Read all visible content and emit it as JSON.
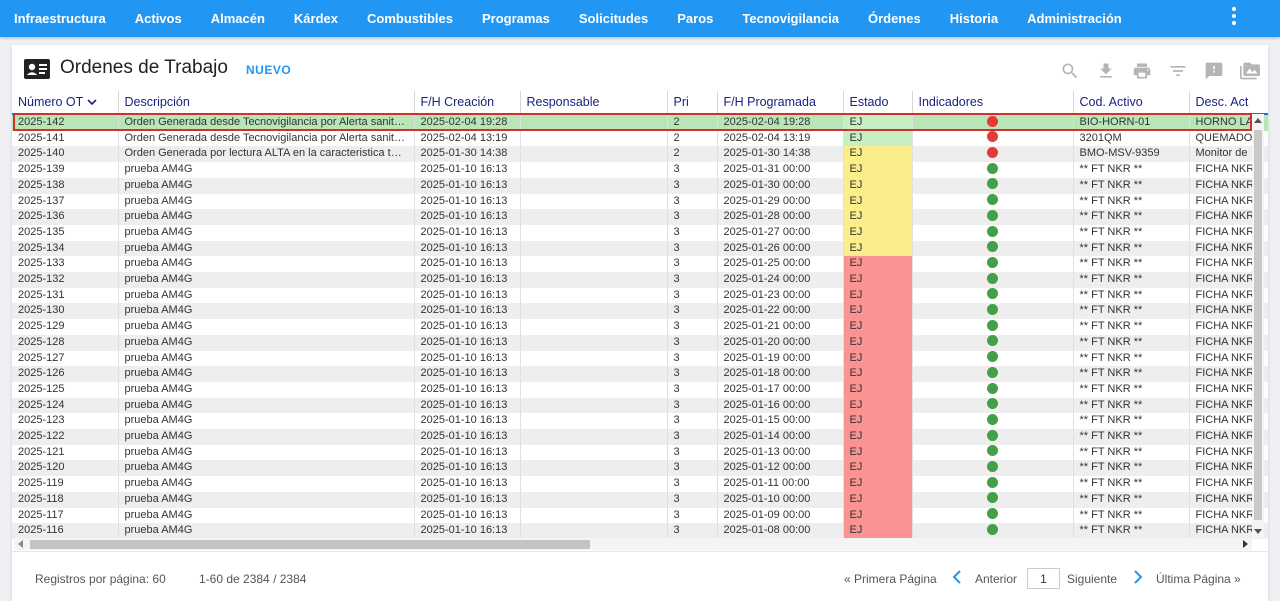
{
  "nav": {
    "items": [
      "Infraestructura",
      "Activos",
      "Almacén",
      "Kárdex",
      "Combustibles",
      "Programas",
      "Solicitudes",
      "Paros",
      "Tecnovigilancia",
      "Órdenes",
      "Historia",
      "Administración"
    ],
    "more_icon": "more-vert-icon"
  },
  "header": {
    "title": "Ordenes de Trabajo",
    "new_label": "NUEVO",
    "tools": [
      "search-icon",
      "download-icon",
      "print-icon",
      "filter-icon",
      "feedback-icon",
      "gallery-icon"
    ]
  },
  "colors": {
    "nav": "#2196f3",
    "status_green": "#c6f0c2",
    "status_yellow": "#fbee8a",
    "status_red": "#f99493",
    "dot_red": "#e53935",
    "dot_green": "#43a047",
    "selected_outline": "#d32f2f"
  },
  "table": {
    "columns": [
      "Número OT",
      "Descripción",
      "F/H Creación",
      "Responsable",
      "Pri",
      "F/H Programada",
      "Estado",
      "Indicadores",
      "Cod. Activo",
      "Desc. Act"
    ],
    "rows": [
      {
        "ot": "2025-142",
        "desc": "Orden Generada desde Tecnovigilancia por Alerta sanitaria",
        "created": "2025-02-04 19:28",
        "resp": "",
        "pri": "2",
        "sched": "2025-02-04 19:28",
        "estado": "EJ",
        "status": "green",
        "ind": "red",
        "cod": "BIO-HORN-01",
        "descact": "HORNO LA"
      },
      {
        "ot": "2025-141",
        "desc": "Orden Generada desde Tecnovigilancia por Alerta sanitaria",
        "created": "2025-02-04 13:19",
        "resp": "",
        "pri": "2",
        "sched": "2025-02-04 13:19",
        "estado": "EJ",
        "status": "green",
        "ind": "red",
        "cod": "3201QM",
        "descact": "QUEMADOR"
      },
      {
        "ot": "2025-140",
        "desc": "Orden Generada por lectura ALTA en la caracteristica temperatura",
        "created": "2025-01-30 14:38",
        "resp": "",
        "pri": "2",
        "sched": "2025-01-30 14:38",
        "estado": "EJ",
        "status": "yellow",
        "ind": "red",
        "cod": "BMO-MSV-9359",
        "descact": "Monitor de"
      },
      {
        "ot": "2025-139",
        "desc": "prueba AM4G",
        "created": "2025-01-10 16:13",
        "resp": "",
        "pri": "3",
        "sched": "2025-01-31 00:00",
        "estado": "EJ",
        "status": "yellow",
        "ind": "green",
        "cod": "** FT NKR **",
        "descact": "FICHA NKR"
      },
      {
        "ot": "2025-138",
        "desc": "prueba AM4G",
        "created": "2025-01-10 16:13",
        "resp": "",
        "pri": "3",
        "sched": "2025-01-30 00:00",
        "estado": "EJ",
        "status": "yellow",
        "ind": "green",
        "cod": "** FT NKR **",
        "descact": "FICHA NKR"
      },
      {
        "ot": "2025-137",
        "desc": "prueba AM4G",
        "created": "2025-01-10 16:13",
        "resp": "",
        "pri": "3",
        "sched": "2025-01-29 00:00",
        "estado": "EJ",
        "status": "yellow",
        "ind": "green",
        "cod": "** FT NKR **",
        "descact": "FICHA NKR"
      },
      {
        "ot": "2025-136",
        "desc": "prueba AM4G",
        "created": "2025-01-10 16:13",
        "resp": "",
        "pri": "3",
        "sched": "2025-01-28 00:00",
        "estado": "EJ",
        "status": "yellow",
        "ind": "green",
        "cod": "** FT NKR **",
        "descact": "FICHA NKR"
      },
      {
        "ot": "2025-135",
        "desc": "prueba AM4G",
        "created": "2025-01-10 16:13",
        "resp": "",
        "pri": "3",
        "sched": "2025-01-27 00:00",
        "estado": "EJ",
        "status": "yellow",
        "ind": "green",
        "cod": "** FT NKR **",
        "descact": "FICHA NKR"
      },
      {
        "ot": "2025-134",
        "desc": "prueba AM4G",
        "created": "2025-01-10 16:13",
        "resp": "",
        "pri": "3",
        "sched": "2025-01-26 00:00",
        "estado": "EJ",
        "status": "yellow",
        "ind": "green",
        "cod": "** FT NKR **",
        "descact": "FICHA NKR"
      },
      {
        "ot": "2025-133",
        "desc": "prueba AM4G",
        "created": "2025-01-10 16:13",
        "resp": "",
        "pri": "3",
        "sched": "2025-01-25 00:00",
        "estado": "EJ",
        "status": "red",
        "ind": "green",
        "cod": "** FT NKR **",
        "descact": "FICHA NKR"
      },
      {
        "ot": "2025-132",
        "desc": "prueba AM4G",
        "created": "2025-01-10 16:13",
        "resp": "",
        "pri": "3",
        "sched": "2025-01-24 00:00",
        "estado": "EJ",
        "status": "red",
        "ind": "green",
        "cod": "** FT NKR **",
        "descact": "FICHA NKR"
      },
      {
        "ot": "2025-131",
        "desc": "prueba AM4G",
        "created": "2025-01-10 16:13",
        "resp": "",
        "pri": "3",
        "sched": "2025-01-23 00:00",
        "estado": "EJ",
        "status": "red",
        "ind": "green",
        "cod": "** FT NKR **",
        "descact": "FICHA NKR"
      },
      {
        "ot": "2025-130",
        "desc": "prueba AM4G",
        "created": "2025-01-10 16:13",
        "resp": "",
        "pri": "3",
        "sched": "2025-01-22 00:00",
        "estado": "EJ",
        "status": "red",
        "ind": "green",
        "cod": "** FT NKR **",
        "descact": "FICHA NKR"
      },
      {
        "ot": "2025-129",
        "desc": "prueba AM4G",
        "created": "2025-01-10 16:13",
        "resp": "",
        "pri": "3",
        "sched": "2025-01-21 00:00",
        "estado": "EJ",
        "status": "red",
        "ind": "green",
        "cod": "** FT NKR **",
        "descact": "FICHA NKR"
      },
      {
        "ot": "2025-128",
        "desc": "prueba AM4G",
        "created": "2025-01-10 16:13",
        "resp": "",
        "pri": "3",
        "sched": "2025-01-20 00:00",
        "estado": "EJ",
        "status": "red",
        "ind": "green",
        "cod": "** FT NKR **",
        "descact": "FICHA NKR"
      },
      {
        "ot": "2025-127",
        "desc": "prueba AM4G",
        "created": "2025-01-10 16:13",
        "resp": "",
        "pri": "3",
        "sched": "2025-01-19 00:00",
        "estado": "EJ",
        "status": "red",
        "ind": "green",
        "cod": "** FT NKR **",
        "descact": "FICHA NKR"
      },
      {
        "ot": "2025-126",
        "desc": "prueba AM4G",
        "created": "2025-01-10 16:13",
        "resp": "",
        "pri": "3",
        "sched": "2025-01-18 00:00",
        "estado": "EJ",
        "status": "red",
        "ind": "green",
        "cod": "** FT NKR **",
        "descact": "FICHA NKR"
      },
      {
        "ot": "2025-125",
        "desc": "prueba AM4G",
        "created": "2025-01-10 16:13",
        "resp": "",
        "pri": "3",
        "sched": "2025-01-17 00:00",
        "estado": "EJ",
        "status": "red",
        "ind": "green",
        "cod": "** FT NKR **",
        "descact": "FICHA NKR"
      },
      {
        "ot": "2025-124",
        "desc": "prueba AM4G",
        "created": "2025-01-10 16:13",
        "resp": "",
        "pri": "3",
        "sched": "2025-01-16 00:00",
        "estado": "EJ",
        "status": "red",
        "ind": "green",
        "cod": "** FT NKR **",
        "descact": "FICHA NKR"
      },
      {
        "ot": "2025-123",
        "desc": "prueba AM4G",
        "created": "2025-01-10 16:13",
        "resp": "",
        "pri": "3",
        "sched": "2025-01-15 00:00",
        "estado": "EJ",
        "status": "red",
        "ind": "green",
        "cod": "** FT NKR **",
        "descact": "FICHA NKR"
      },
      {
        "ot": "2025-122",
        "desc": "prueba AM4G",
        "created": "2025-01-10 16:13",
        "resp": "",
        "pri": "3",
        "sched": "2025-01-14 00:00",
        "estado": "EJ",
        "status": "red",
        "ind": "green",
        "cod": "** FT NKR **",
        "descact": "FICHA NKR"
      },
      {
        "ot": "2025-121",
        "desc": "prueba AM4G",
        "created": "2025-01-10 16:13",
        "resp": "",
        "pri": "3",
        "sched": "2025-01-13 00:00",
        "estado": "EJ",
        "status": "red",
        "ind": "green",
        "cod": "** FT NKR **",
        "descact": "FICHA NKR"
      },
      {
        "ot": "2025-120",
        "desc": "prueba AM4G",
        "created": "2025-01-10 16:13",
        "resp": "",
        "pri": "3",
        "sched": "2025-01-12 00:00",
        "estado": "EJ",
        "status": "red",
        "ind": "green",
        "cod": "** FT NKR **",
        "descact": "FICHA NKR"
      },
      {
        "ot": "2025-119",
        "desc": "prueba AM4G",
        "created": "2025-01-10 16:13",
        "resp": "",
        "pri": "3",
        "sched": "2025-01-11 00:00",
        "estado": "EJ",
        "status": "red",
        "ind": "green",
        "cod": "** FT NKR **",
        "descact": "FICHA NKR"
      },
      {
        "ot": "2025-118",
        "desc": "prueba AM4G",
        "created": "2025-01-10 16:13",
        "resp": "",
        "pri": "3",
        "sched": "2025-01-10 00:00",
        "estado": "EJ",
        "status": "red",
        "ind": "green",
        "cod": "** FT NKR **",
        "descact": "FICHA NKR"
      },
      {
        "ot": "2025-117",
        "desc": "prueba AM4G",
        "created": "2025-01-10 16:13",
        "resp": "",
        "pri": "3",
        "sched": "2025-01-09 00:00",
        "estado": "EJ",
        "status": "red",
        "ind": "green",
        "cod": "** FT NKR **",
        "descact": "FICHA NKR"
      },
      {
        "ot": "2025-116",
        "desc": "prueba AM4G",
        "created": "2025-01-10 16:13",
        "resp": "",
        "pri": "3",
        "sched": "2025-01-08 00:00",
        "estado": "EJ",
        "status": "red",
        "ind": "green",
        "cod": "** FT NKR **",
        "descact": "FICHA NKR"
      }
    ]
  },
  "footer": {
    "per_page": "Registros por página: 60",
    "range": "1-60 de 2384 / 2384",
    "first": "« Primera Página",
    "prev": "Anterior",
    "page": "1",
    "next": "Siguiente",
    "last": "Última Página »"
  }
}
